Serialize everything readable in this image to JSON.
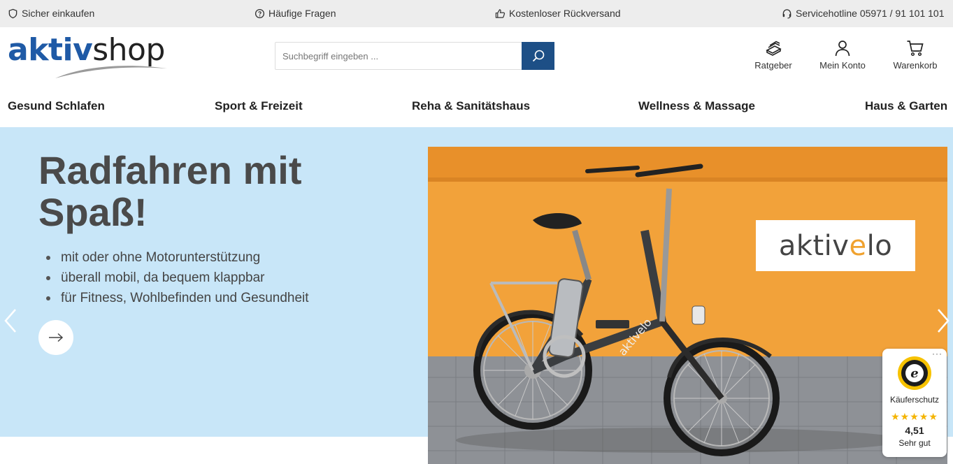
{
  "topbar": {
    "items": [
      {
        "label": "Sicher einkaufen",
        "icon": "shield-icon"
      },
      {
        "label": "Häufige Fragen",
        "icon": "question-icon"
      },
      {
        "label": "Kostenloser Rückversand",
        "icon": "thumbs-up-icon"
      },
      {
        "label": "Servicehotline 05971 / 91 101 101",
        "icon": "headset-icon"
      }
    ]
  },
  "header": {
    "logo_part1": "aktiv",
    "logo_part2": "shop",
    "search_placeholder": "Suchbegriff eingeben ...",
    "actions": [
      {
        "label": "Ratgeber",
        "icon": "book-icon"
      },
      {
        "label": "Mein Konto",
        "icon": "user-icon"
      },
      {
        "label": "Warenkorb",
        "icon": "cart-icon"
      }
    ]
  },
  "nav": {
    "items": [
      "Gesund Schlafen",
      "Sport & Freizeit",
      "Reha & Sanitätshaus",
      "Wellness & Massage",
      "Haus & Garten"
    ]
  },
  "hero": {
    "title": "Radfahren mit Spaß!",
    "bullets": [
      "mit oder ohne Motorunterstützung",
      "überall mobil, da bequem klappbar",
      "für Fitness, Wohlbefinden und Gesundheit"
    ],
    "brand_prefix": "aktiv",
    "brand_accent": "e",
    "brand_suffix": "lo",
    "frame_text": "aktivelo"
  },
  "trust_badge": {
    "label": "Käuferschutz",
    "stars": "★★★★★",
    "score": "4,51",
    "rating_text": "Sehr gut"
  },
  "colors": {
    "topbar_bg": "#ededed",
    "brand_blue": "#1f5aa6",
    "search_button": "#1d4f86",
    "hero_bg": "#c8e6f8",
    "photo_orange": "#f2a23a",
    "accent_orange": "#f0a22f"
  }
}
